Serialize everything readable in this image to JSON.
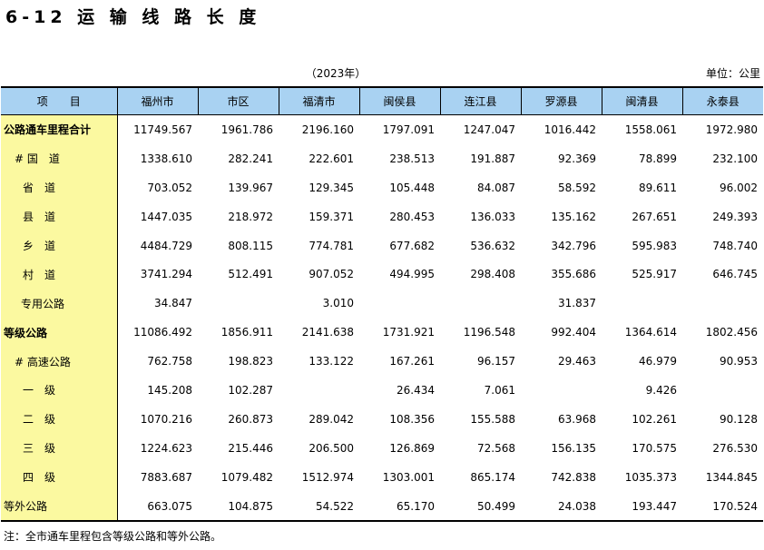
{
  "title": "6-12 运 输 线 路 长 度",
  "year_note": "（2023年）",
  "unit": "单位：公里",
  "columns": [
    "项　　目",
    "福州市",
    "市区",
    "福清市",
    "闽侯县",
    "连江县",
    "罗源县",
    "闽清县",
    "永泰县"
  ],
  "rows": [
    {
      "label": "公路通车里程合计",
      "level": 0,
      "values": [
        "11749.567",
        "1961.786",
        "2196.160",
        "1797.091",
        "1247.047",
        "1016.442",
        "1558.061",
        "1972.980"
      ]
    },
    {
      "label": "# 国　道",
      "level": 1,
      "values": [
        "1338.610",
        "282.241",
        "222.601",
        "238.513",
        "191.887",
        "92.369",
        "78.899",
        "232.100"
      ]
    },
    {
      "label": "省　道",
      "level": 2,
      "values": [
        "703.052",
        "139.967",
        "129.345",
        "105.448",
        "84.087",
        "58.592",
        "89.611",
        "96.002"
      ]
    },
    {
      "label": "县　道",
      "level": 2,
      "values": [
        "1447.035",
        "218.972",
        "159.371",
        "280.453",
        "136.033",
        "135.162",
        "267.651",
        "249.393"
      ]
    },
    {
      "label": "乡　道",
      "level": 2,
      "values": [
        "4484.729",
        "808.115",
        "774.781",
        "677.682",
        "536.632",
        "342.796",
        "595.983",
        "748.740"
      ]
    },
    {
      "label": "村　道",
      "level": 2,
      "values": [
        "3741.294",
        "512.491",
        "907.052",
        "494.995",
        "298.408",
        "355.686",
        "525.917",
        "646.745"
      ]
    },
    {
      "label": "专用公路",
      "level": 3,
      "values": [
        "34.847",
        "",
        "3.010",
        "",
        "",
        "31.837",
        "",
        ""
      ]
    },
    {
      "label": "等级公路",
      "level": 0,
      "values": [
        "11086.492",
        "1856.911",
        "2141.638",
        "1731.921",
        "1196.548",
        "992.404",
        "1364.614",
        "1802.456"
      ]
    },
    {
      "label": "# 高速公路",
      "level": 1,
      "values": [
        "762.758",
        "198.823",
        "133.122",
        "167.261",
        "96.157",
        "29.463",
        "46.979",
        "90.953"
      ]
    },
    {
      "label": "一　级",
      "level": 2,
      "values": [
        "145.208",
        "102.287",
        "",
        "26.434",
        "7.061",
        "",
        "9.426",
        ""
      ]
    },
    {
      "label": "二　级",
      "level": 2,
      "values": [
        "1070.216",
        "260.873",
        "289.042",
        "108.356",
        "155.588",
        "63.968",
        "102.261",
        "90.128"
      ]
    },
    {
      "label": "三　级",
      "level": 2,
      "values": [
        "1224.623",
        "215.446",
        "206.500",
        "126.869",
        "72.568",
        "156.135",
        "170.575",
        "276.530"
      ]
    },
    {
      "label": "四　级",
      "level": 2,
      "values": [
        "7883.687",
        "1079.482",
        "1512.974",
        "1303.001",
        "865.174",
        "742.838",
        "1035.373",
        "1344.845"
      ]
    },
    {
      "label": "等外公路",
      "level": 4,
      "values": [
        "663.075",
        "104.875",
        "54.522",
        "65.170",
        "50.499",
        "24.038",
        "193.447",
        "170.524"
      ]
    }
  ],
  "footnote": "注：全市通车里程包含等级公路和等外公路。",
  "colors": {
    "header_bg": "#a9d2f2",
    "label_bg": "#fbf9a0"
  }
}
